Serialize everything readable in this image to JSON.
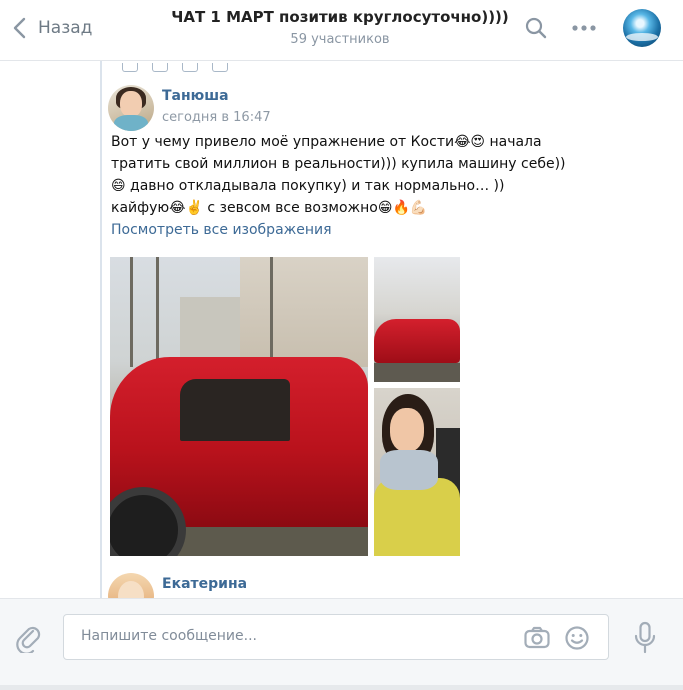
{
  "header": {
    "back_label": "Назад",
    "title": "ЧАТ 1 МАРТ позитив круглосуточно))))",
    "subtitle": "59 участников"
  },
  "message": {
    "author": "Танюша",
    "time": "сегодня в 16:47",
    "text": "Вот у чему привело моё упражнение от Кости😂😍 начала\nтратить свой миллион в реальности))) купила машину себе))\n😄 давно откладывала покупку) и так нормально… ))\nкайфую😂✌️ с зевсом все возможно😁🔥💪🏻",
    "view_all_label": "Посмотреть все изображения"
  },
  "next_message": {
    "author": "Екатерина"
  },
  "composer": {
    "placeholder": "Напишите сообщение..."
  },
  "icons": [
    "chevron-left-icon",
    "search-icon",
    "more-icon",
    "paperclip-icon",
    "camera-icon",
    "smile-icon",
    "microphone-icon"
  ],
  "colors": {
    "link": "#3d6a96",
    "muted": "#8e99a5",
    "divider": "#dbe3ec"
  }
}
